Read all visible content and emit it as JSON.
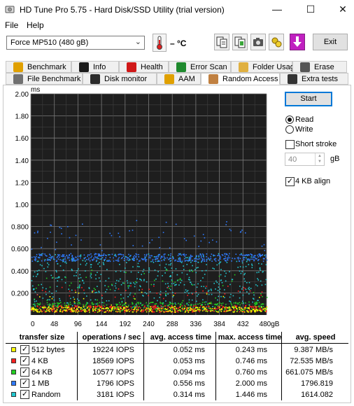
{
  "window": {
    "title": "HD Tune Pro 5.75 - Hard Disk/SSD Utility (trial version)",
    "minimize": "—",
    "maximize": "☐",
    "close": "✕"
  },
  "menu": {
    "file": "File",
    "help": "Help"
  },
  "toolbar": {
    "drive": "Force MP510 (480 gB)",
    "temperature": "– °C",
    "exit": "Exit"
  },
  "tabs": {
    "row1": [
      {
        "label": "Benchmark",
        "icon": "benchmark-icon"
      },
      {
        "label": "Info",
        "icon": "info-icon"
      },
      {
        "label": "Health",
        "icon": "health-icon"
      },
      {
        "label": "Error Scan",
        "icon": "error-scan-icon"
      },
      {
        "label": "Folder Usage",
        "icon": "folder-icon"
      },
      {
        "label": "Erase",
        "icon": "erase-icon"
      }
    ],
    "row2": [
      {
        "label": "File Benchmark",
        "icon": "file-benchmark-icon"
      },
      {
        "label": "Disk monitor",
        "icon": "disk-monitor-icon"
      },
      {
        "label": "AAM",
        "icon": "speaker-icon"
      },
      {
        "label": "Random Access",
        "icon": "random-access-icon",
        "active": true
      },
      {
        "label": "Extra tests",
        "icon": "extra-tests-icon"
      }
    ]
  },
  "controls": {
    "start": "Start",
    "read": "Read",
    "write": "Write",
    "mode_selected": "read",
    "short_stroke": "Short stroke",
    "short_stroke_checked": false,
    "short_stroke_value": "40",
    "short_stroke_unit": "gB",
    "align_4kb": "4 KB align",
    "align_4kb_checked": true
  },
  "chart_data": {
    "type": "scatter",
    "y_unit": "ms",
    "ylim": [
      0,
      2.0
    ],
    "y_ticks": [
      "2.00",
      "1.80",
      "1.60",
      "1.40",
      "1.20",
      "1.00",
      "0.800",
      "0.600",
      "0.400",
      "0.200"
    ],
    "x_ticks": [
      "0",
      "48",
      "96",
      "144",
      "192",
      "240",
      "288",
      "336",
      "384",
      "432",
      "480gB"
    ],
    "xlim": [
      0,
      480
    ],
    "grid": true,
    "background": "#1e1e1e",
    "series": [
      {
        "name": "512 bytes",
        "color": "#ffff00",
        "typical_ms": 0.052,
        "max_ms": 0.243
      },
      {
        "name": "4 KB",
        "color": "#ff2020",
        "typical_ms": 0.053,
        "max_ms": 0.746
      },
      {
        "name": "64 KB",
        "color": "#22d022",
        "typical_ms": 0.094,
        "max_ms": 0.76
      },
      {
        "name": "1 MB",
        "color": "#2f7bff",
        "typical_ms": 0.556,
        "max_ms": 2.0
      },
      {
        "name": "Random",
        "color": "#22c8d0",
        "typical_ms": 0.314,
        "max_ms": 1.446
      }
    ]
  },
  "results": {
    "headers": [
      "transfer size",
      "operations / sec",
      "avg. access time",
      "max. access time",
      "avg. speed"
    ],
    "rows": [
      {
        "size": "512 bytes",
        "color": "#ffff00",
        "ops": "19224 IOPS",
        "avg": "0.052 ms",
        "max": "0.243 ms",
        "speed": "9.387 MB/s"
      },
      {
        "size": "4 KB",
        "color": "#ff2020",
        "ops": "18569 IOPS",
        "avg": "0.053 ms",
        "max": "0.746 ms",
        "speed": "72.535 MB/s"
      },
      {
        "size": "64 KB",
        "color": "#22d022",
        "ops": "10577 IOPS",
        "avg": "0.094 ms",
        "max": "0.760 ms",
        "speed": "661.075 MB/s"
      },
      {
        "size": "1 MB",
        "color": "#2f7bff",
        "ops": "1796 IOPS",
        "avg": "0.556 ms",
        "max": "2.000 ms",
        "speed": "1796.819"
      },
      {
        "size": "Random",
        "color": "#22c8d0",
        "ops": "3181 IOPS",
        "avg": "0.314 ms",
        "max": "1.446 ms",
        "speed": "1614.082"
      }
    ]
  }
}
